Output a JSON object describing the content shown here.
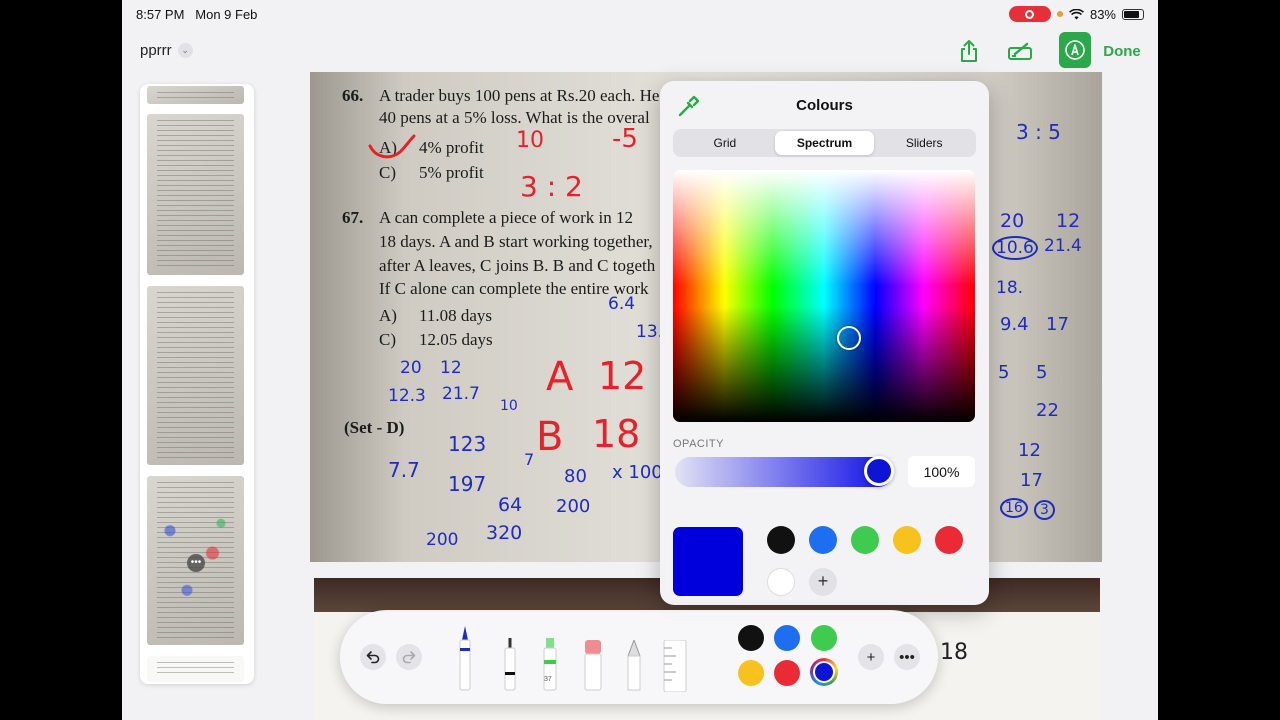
{
  "status": {
    "time": "8:57 PM",
    "date": "Mon 9 Feb",
    "battery": "83%",
    "battery_level": 0.83
  },
  "nav": {
    "title": "pprrr",
    "done_label": "Done"
  },
  "document": {
    "q66": {
      "number": "66.",
      "line1": "A trader buys 100 pens at Rs.20 each. He",
      "line2": "40 pens at a 5% loss. What is the overal",
      "opt_a_letter": "A)",
      "opt_a": "4% profit",
      "opt_c_letter": "C)",
      "opt_c": "5% profit"
    },
    "q67": {
      "number": "67.",
      "line1": "A can complete a piece of work in 12",
      "line2": "18 days. A and B start working together,",
      "line3": "after A leaves, C joins B. B and C togeth",
      "line4": "If C alone can complete the entire work",
      "opt_a_letter": "A)",
      "opt_a": "11.08 days",
      "opt_c_letter": "C)",
      "opt_c": "12.05 days"
    },
    "set_label": "(Set - D)",
    "annotations": {
      "red": [
        "10",
        "-5",
        "3 : 2",
        "A",
        "12",
        "B",
        "18"
      ],
      "blue": [
        "6.4",
        "13.",
        "20",
        "12",
        "12.3",
        "21.7",
        "10",
        "123",
        "7.7",
        "197",
        "7",
        "64",
        "200",
        "320",
        "x 100",
        "80",
        "200"
      ],
      "right_column": [
        "3 : 5",
        "20",
        "12",
        "10.6",
        "21.4",
        "18.",
        "9.4",
        "17",
        "5",
        "5",
        "22",
        "12",
        "17",
        "16",
        "3",
        "18"
      ]
    }
  },
  "popover": {
    "title": "Colours",
    "tabs": [
      "Grid",
      "Spectrum",
      "Sliders"
    ],
    "active_tab": "Spectrum",
    "opacity_label": "OPACITY",
    "opacity_value": "100%",
    "opacity": 1.0,
    "current_color": "#0000dd",
    "swatches": [
      "#111111",
      "#1e6ff0",
      "#3ecb4f",
      "#f7c21d",
      "#ea2b35",
      "#ffffff"
    ]
  },
  "toolbar": {
    "tool_size_label": "37",
    "tools": [
      "pen",
      "fineliner",
      "marker",
      "eraser",
      "pencil",
      "ruler"
    ],
    "swatches": [
      "#111111",
      "#1e6ff0",
      "#3ecb4f",
      "#f7c21d",
      "#ea2b35"
    ],
    "selected_color": "#0e14d4"
  }
}
